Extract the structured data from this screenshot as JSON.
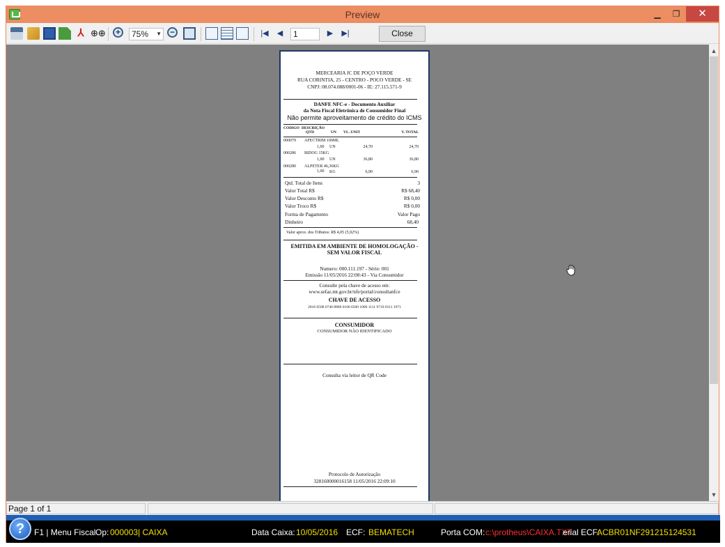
{
  "window": {
    "title": "Preview"
  },
  "titlebar_buttons": {
    "minimize": "▁",
    "maximize": "❐",
    "close": "✕"
  },
  "toolbar": {
    "zoom_value": "75%",
    "page_value": "1",
    "close_label": "Close",
    "icons": [
      "print-icon",
      "open-icon",
      "save-icon",
      "export-icon",
      "pdf-icon",
      "find-icon",
      "zoom-in-icon",
      "zoom-out-icon",
      "fit-page-icon",
      "single-page-icon",
      "multi-page-icon",
      "book-view-icon",
      "first-page-icon",
      "prev-page-icon",
      "next-page-icon",
      "last-page-icon"
    ]
  },
  "receipt": {
    "store_name": "MERCEARIA JC DE POÇO VERDE",
    "address": "RUA CORINTIA, 25 - CENTRO - POCO VERDE - SE",
    "cnpj": "CNPJ: 08.074.088/0001-06 - IE: 27.115.571-9",
    "danfe_title": "DANFE NFC-e - Documento Auxiliar",
    "danfe_sub": "da Nota Fiscal Eletrônica de Consumidor Final",
    "icms_note": "Não permite aproveitamento de crédito do ICMS",
    "col_headers": {
      "code": "CODIGO",
      "desc": "DESCRIÇÃO",
      "qtd": "QTD",
      "un": "UN",
      "vl_unit": "VL. UNIT",
      "vl_total": "V. TOTAL"
    },
    "items": [
      {
        "code": "000079",
        "desc": "AFECTRIM 100ML",
        "qtd": "1,00",
        "un": "UN",
        "unit": "24,70",
        "total": "24,70"
      },
      {
        "code": "000286",
        "desc": "BIDOG 15KG",
        "qtd": "1,00",
        "un": "UN",
        "unit": "36,80",
        "total": "36,80"
      },
      {
        "code": "000280",
        "desc": "ALPETER 46,36KG",
        "qtd": "1,00",
        "un": "KG",
        "unit": "6,90",
        "total": "6,90"
      }
    ],
    "totals": [
      {
        "label": "Qtd. Total de Itens",
        "value": "3"
      },
      {
        "label": "Valor Total R$",
        "value": "R$ 68,40"
      },
      {
        "label": "Valor Desconto R$",
        "value": "R$ 0,00"
      },
      {
        "label": "Valor Troco R$",
        "value": "R$ 0,00"
      }
    ],
    "payment_label": "Forma de Pagamento",
    "payment_value_label": "Valor Pago",
    "payment_method": "Dinheiro",
    "payment_amount": "68,40",
    "tributos": "Valor aprox. dos Tributos:   R$ 4,05 (5,92%)",
    "homolog_line1": "EMITIDA EM AMBIENTE DE HOMOLOGAÇÃO -",
    "homolog_line2": "SEM VALOR FISCAL",
    "numero": "Numero: 000.111.197 - Série: 001",
    "emissao": "Emissão 11/05/2016 22:08:43 - Via Consumidor",
    "consulta": "Consulte pela chave de acesso em:",
    "consulta_url": "www.sefaz.mt.gov.br/nfe/portal/consultanfce",
    "chave_title": "CHAVE DE ACESSO",
    "chave": "2816 0508 0740 8800 0106 6500 1000 1111 9710 0111 1971",
    "consumidor_title": "CONSUMIDOR",
    "consumidor_sub": "CONSUMIDOR NÃO IDENTIFICADO",
    "qr_label": "Consulta via leitor de QR Code",
    "protocolo_title": "Protocolo de Autorização",
    "protocolo": "328160000016158 11/05/2016 22:09:10"
  },
  "status": {
    "page": "Page 1 of 1"
  },
  "bottom": {
    "help": "?",
    "menu": "F1 | Menu Fiscal",
    "op_label": "Op:",
    "op_value": "000003| CAIXA",
    "data_label": "Data Caixa:",
    "data_value": "10/05/2016",
    "ecf_label": "ECF:",
    "ecf_value": "BEMATECH",
    "porta_label": "Porta COM:",
    "porta_value": "c:\\protheus\\CAIXA.TXT",
    "serial_label": "erial ECF:",
    "serial_value": "ACBR01NF291215124531"
  },
  "colors": {
    "title_bar": "#ec8d62",
    "close_button": "#c74742",
    "bottom_bar": "#000000",
    "accent_blue": "#1f5fb4",
    "yellow_text": "#f3e000",
    "red_text": "#ff3030"
  }
}
